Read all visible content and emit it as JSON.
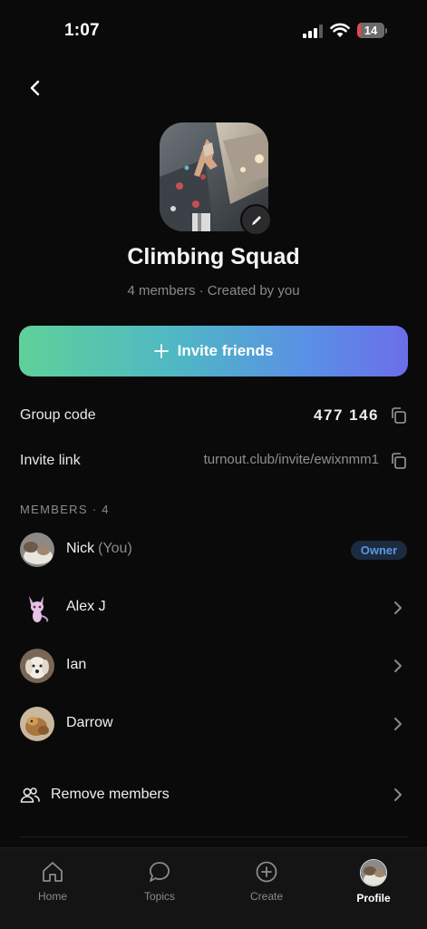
{
  "status_bar": {
    "time": "1:07",
    "battery": "14",
    "battery_level": 0.14
  },
  "group": {
    "name": "Climbing Squad",
    "meta": "4 members · Created by you"
  },
  "invite_button": {
    "label": "Invite friends"
  },
  "group_code": {
    "label": "Group code",
    "value": "477 146"
  },
  "invite_link": {
    "label": "Invite link",
    "value": "turnout.club/invite/ewixnmm1"
  },
  "members_section": {
    "header": "MEMBERS · 4"
  },
  "members": [
    {
      "name": "Nick",
      "you": "(You)",
      "badge": "Owner"
    },
    {
      "name": "Alex J"
    },
    {
      "name": "Ian"
    },
    {
      "name": "Darrow"
    }
  ],
  "remove_members": {
    "label": "Remove members"
  },
  "tabs": [
    {
      "label": "Home",
      "icon": "home-icon"
    },
    {
      "label": "Topics",
      "icon": "chat-bubble-icon"
    },
    {
      "label": "Create",
      "icon": "plus-circle-icon"
    },
    {
      "label": "Profile",
      "icon": "profile-avatar",
      "active": true
    }
  ],
  "colors": {
    "background": "#0a0a0a",
    "invite_gradient_start": "#5fd19a",
    "invite_gradient_end": "#6b6ee8",
    "owner_badge_text": "#5c97e0",
    "battery_low": "#e5484d"
  }
}
